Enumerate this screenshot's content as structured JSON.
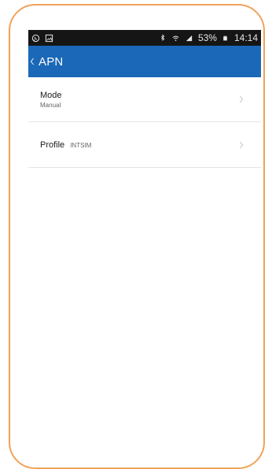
{
  "status_bar": {
    "left_icons": [
      "whatsapp-icon",
      "gallery-icon"
    ],
    "right_icons": [
      "bluetooth-icon",
      "wifi-icon",
      "signal-icon",
      "battery-icon"
    ],
    "battery_percent": "53%",
    "time": "14:14"
  },
  "toolbar": {
    "title": "APN",
    "back_icon": "chevron-left-icon"
  },
  "list": {
    "items": [
      {
        "title": "Mode",
        "value": "Manual",
        "arrow_icon": "chevron-right-icon"
      },
      {
        "title": "Profile",
        "value": "INTSIM",
        "arrow_icon": "chevron-right-icon"
      }
    ]
  },
  "colors": {
    "frame_border": "#f0a25a",
    "status_bar": "#151515",
    "toolbar": "#1a68b7",
    "divider": "#e4e4e4"
  }
}
